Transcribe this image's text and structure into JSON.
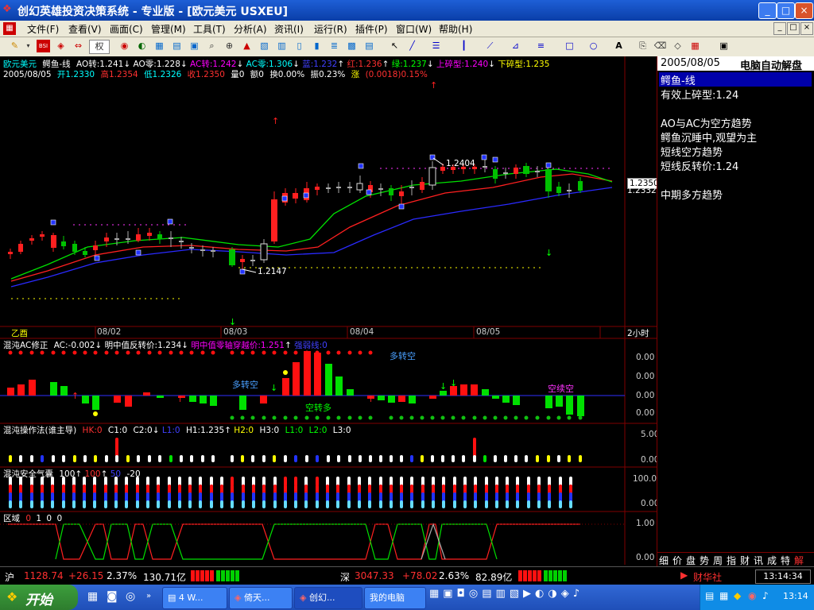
{
  "window": {
    "title": "创幻英雄投资决策系统 - 专业版 - [欧元美元 USXEU]",
    "min_label": "_",
    "max_label": "□",
    "close_label": "×",
    "doc_min_label": "_",
    "doc_max_label": "□",
    "doc_close_label": "×"
  },
  "menu": [
    {
      "label": "文件(F)"
    },
    {
      "label": "查看(V)"
    },
    {
      "label": "画面(C)"
    },
    {
      "label": "管理(M)"
    },
    {
      "label": "工具(T)"
    },
    {
      "label": "分析(A)"
    },
    {
      "label": "资讯(I)"
    },
    {
      "label": "运行(R)"
    },
    {
      "label": "插件(P)"
    },
    {
      "label": "窗口(W)"
    },
    {
      "label": "帮助(H)"
    }
  ],
  "toolbar": {
    "quan_label": "权",
    "letter_a": "A"
  },
  "header": {
    "line1": [
      {
        "text": "欧元美元",
        "color": "#00ffff"
      },
      {
        "text": "鳄鱼-线",
        "color": "#ffffff"
      },
      {
        "text": "AO转:1.241",
        "color": "#ffffff"
      },
      {
        "text": "AO零:1.228",
        "color": "#ffffff"
      },
      {
        "text": "AC转:1.242",
        "color": "#ff00ff"
      },
      {
        "text": "AC零:1.306",
        "color": "#00ffff"
      },
      {
        "text": "蓝:1.232",
        "color": "#3030ff"
      },
      {
        "text": "红:1.236",
        "color": "#ff3030"
      },
      {
        "text": "绿:1.237",
        "color": "#00ff00"
      },
      {
        "text": "上碎型:1.240",
        "color": "#ff00ff"
      },
      {
        "text": "下碎型:1.235",
        "color": "#ffff00"
      }
    ],
    "line2": [
      {
        "text": "2005/08/05",
        "color": "#ffffff"
      },
      {
        "text": "开1.2330",
        "color": "#00ffff"
      },
      {
        "text": "高1.2354",
        "color": "#ff3030"
      },
      {
        "text": "低1.2326",
        "color": "#00ffff"
      },
      {
        "text": "收1.2350",
        "color": "#ff3030"
      },
      {
        "text": "量0",
        "color": "#ffffff"
      },
      {
        "text": "额0",
        "color": "#ffffff"
      },
      {
        "text": "换0.00%",
        "color": "#ffffff"
      },
      {
        "text": "振0.23%",
        "color": "#ffffff"
      },
      {
        "text": "涨",
        "color": "#ffff00"
      },
      {
        "text": "(0.0018)0.15%",
        "color": "#ff3030"
      }
    ]
  },
  "price_chart": {
    "price_tag_high": "1.2350",
    "price_tag_low": "1.2332",
    "annot_high": "1.2404",
    "annot_low": "1.2147",
    "xaxis_left": "乙酉",
    "dates": [
      "08/02",
      "08/03",
      "08/04",
      "08/05"
    ],
    "period": "2小时"
  },
  "indicator_ac": {
    "title_parts": [
      {
        "text": "混沌AC修正",
        "color": "#ffffff"
      },
      {
        "text": "AC:-0.002",
        "color": "#ffffff"
      },
      {
        "text": "明中值反转价:1.234",
        "color": "#ffffff"
      },
      {
        "text": "明中值零轴穿越价:1.251",
        "color": "#ff00ff"
      },
      {
        "text": "强弱线:0",
        "color": "#3030ff"
      }
    ],
    "text_duozhuankong": "多转空",
    "text_duozhuankong2": "多转空",
    "text_kongzhuanduo": "空转多",
    "text_kongxukong": "空续空",
    "axis": [
      "0.00",
      "0.00",
      "0.00",
      "0.00"
    ]
  },
  "indicator_caozuo": {
    "title_parts": [
      {
        "text": "混沌操作法(谁主导)",
        "color": "#ffffff"
      },
      {
        "text": "HK:0",
        "color": "#ff3030"
      },
      {
        "text": "C1:0",
        "color": "#ffffff"
      },
      {
        "text": "C2:0",
        "color": "#ffffff"
      },
      {
        "text": "L1:0",
        "color": "#3030ff"
      },
      {
        "text": "H1:1.235",
        "color": "#ffffff"
      },
      {
        "text": "H2:0",
        "color": "#ffff00"
      },
      {
        "text": "H3:0",
        "color": "#ffffff"
      },
      {
        "text": "L1:0",
        "color": "#00ff00"
      },
      {
        "text": "L2:0",
        "color": "#00ff00"
      },
      {
        "text": "L3:0",
        "color": "#ffffff"
      }
    ],
    "axis": [
      "5.00",
      "0.00"
    ]
  },
  "indicator_airbag": {
    "title_parts": [
      {
        "text": "混沌安全气囊",
        "color": "#ffffff"
      },
      {
        "text": "100",
        "color": "#ffffff"
      },
      {
        "text": "100",
        "color": "#ff3030"
      },
      {
        "text": "50",
        "color": "#3030ff"
      },
      {
        "text": "-20",
        "color": "#ffffff"
      }
    ],
    "axis": [
      "100.00",
      "0.00"
    ]
  },
  "indicator_zone": {
    "title_parts": [
      {
        "text": "区域",
        "color": "#ffffff"
      },
      {
        "text": "0",
        "color": "#ff3030"
      },
      {
        "text": "1",
        "color": "#ffffff"
      },
      {
        "text": "0",
        "color": "#ffffff"
      },
      {
        "text": "0",
        "color": "#ffffff"
      }
    ],
    "axis": [
      "1.00",
      "0.00"
    ]
  },
  "side_panel": {
    "date": "2005/08/05",
    "title": "电脑自动解盘",
    "lines": [
      {
        "text": "鳄鱼-线",
        "highlight": true
      },
      {
        "text": "有效上碎型:1.24",
        "highlight": false
      },
      {
        "text": "",
        "highlight": false
      },
      {
        "text": "AO与AC为空方趋势",
        "highlight": false
      },
      {
        "text": "鳄鱼沉睡中,观望为主",
        "highlight": false
      },
      {
        "text": "短线空方趋势",
        "highlight": false
      },
      {
        "text": "短线反转价:1.24",
        "highlight": false
      },
      {
        "text": "",
        "highlight": false
      },
      {
        "text": "中期多方趋势",
        "highlight": false
      }
    ],
    "tabs": [
      "细",
      "价",
      "盘",
      "势",
      "周",
      "指",
      "财",
      "讯",
      "成",
      "特",
      "解"
    ]
  },
  "status": {
    "sh_label": "沪",
    "sh_value": "1128.74",
    "sh_change": "+26.15",
    "sh_pct": "2.37%",
    "sh_amount": "130.71亿",
    "sz_label": "深",
    "sz_value": "3047.33",
    "sz_change": "+78.02",
    "sz_pct": "2.63%",
    "sz_amount": "82.89亿",
    "news": "财华社",
    "time": "13:14:34"
  },
  "taskbar": {
    "start": "开始",
    "tasks": [
      "4 W...",
      "倚天...",
      "创幻...",
      "我的电脑"
    ],
    "clock": "13:14"
  }
}
